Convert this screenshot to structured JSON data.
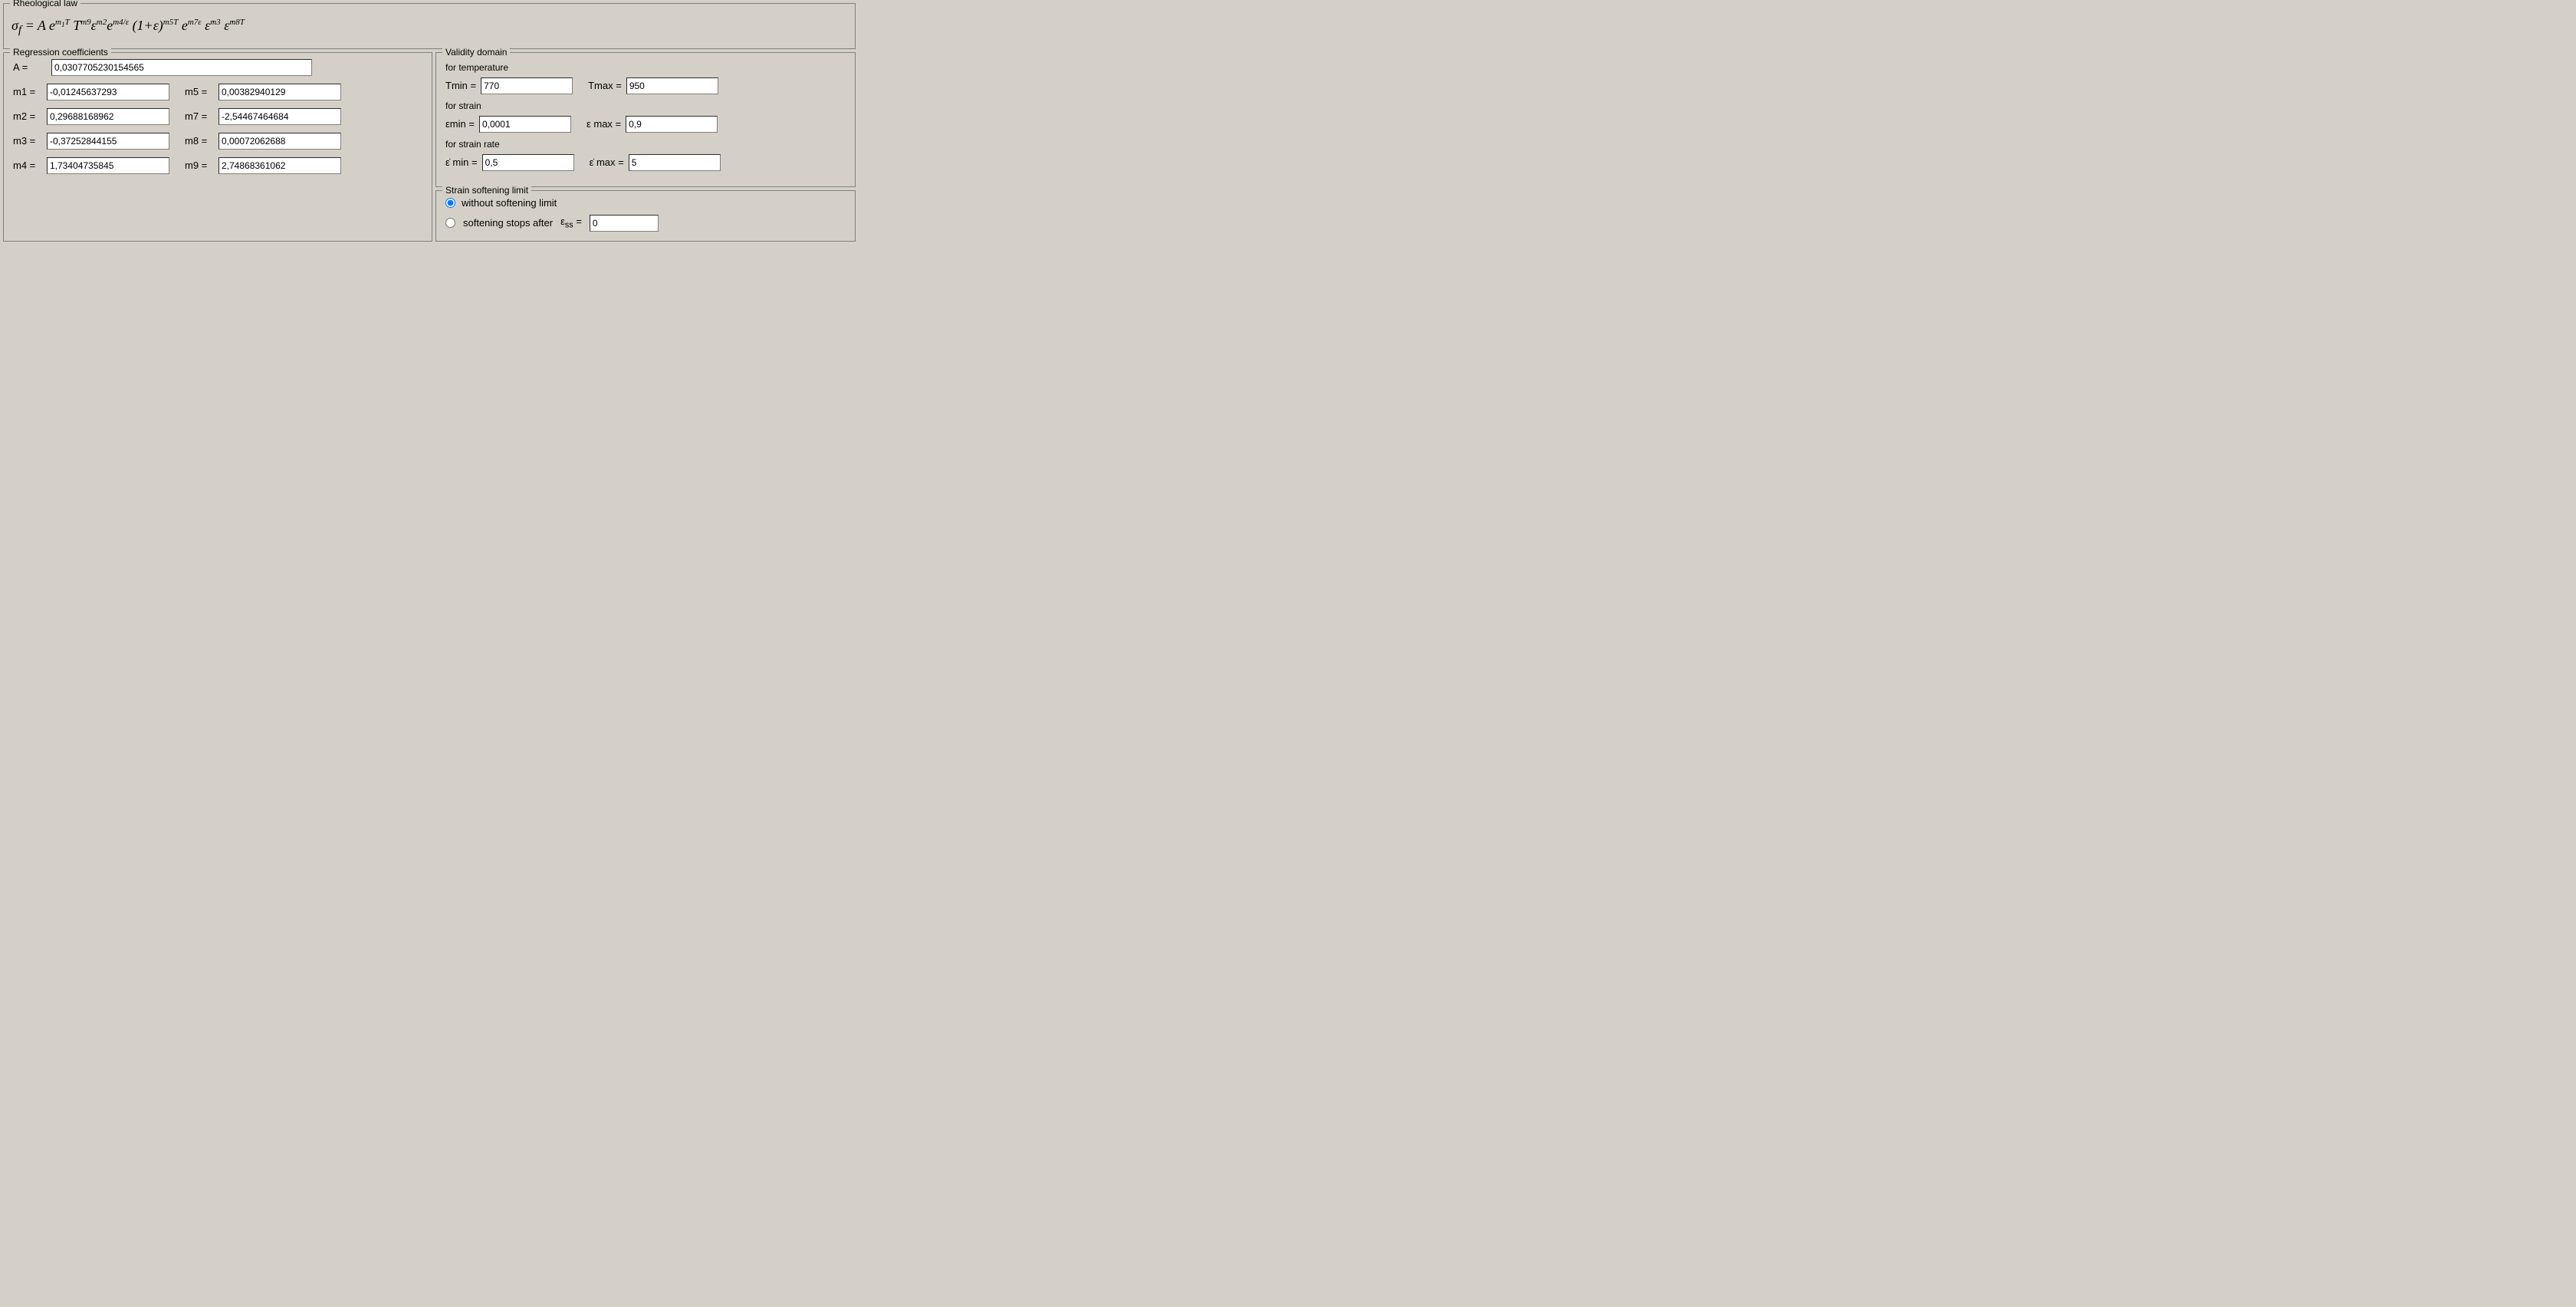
{
  "rheological": {
    "title": "Rheological law",
    "formula": "σf = A e^(m₁T) T^m9 ε^m2 e^(m4/ε) (1+ε)^(m5T) e^(m7ε) έ^m3 έ^(m8T)"
  },
  "regression": {
    "title": "Regression coefficients",
    "A_label": "A  =",
    "A_value": "0,0307705230154565",
    "coefficients": [
      {
        "left_label": "m1 =",
        "left_value": "-0,01245637293",
        "right_label": "m5 =",
        "right_value": "0,00382940129"
      },
      {
        "left_label": "m2 =",
        "left_value": "0,29688168962",
        "right_label": "m7 =",
        "right_value": "-2,54467464684"
      },
      {
        "left_label": "m3 =",
        "left_value": "-0,37252844155",
        "right_label": "m8 =",
        "right_value": "0,00072062688"
      },
      {
        "left_label": "m4 =",
        "left_value": "1,73404735845",
        "right_label": "m9 =",
        "right_value": "2,74868361062"
      }
    ]
  },
  "validity": {
    "title": "Validity domain",
    "temperature_label": "for temperature",
    "tmin_label": "Tmin =",
    "tmin_value": "770",
    "tmax_label": "Tmax =",
    "tmax_value": "950",
    "strain_label": "for strain",
    "emin_label": "εmin =",
    "emin_value": "0,0001",
    "emax_label": "ε max =",
    "emax_value": "0,9",
    "strain_rate_label": "for strain rate",
    "edot_min_label": "έ min =",
    "edot_min_value": "0,5",
    "edot_max_label": "έ max =",
    "edot_max_value": "5"
  },
  "strain_softening": {
    "title": "Strain softening limit",
    "radio1_label": "without softening limit",
    "radio2_label": "softening stops after",
    "ess_label": "εss =",
    "ess_value": "0",
    "radio1_checked": true,
    "radio2_checked": false
  }
}
